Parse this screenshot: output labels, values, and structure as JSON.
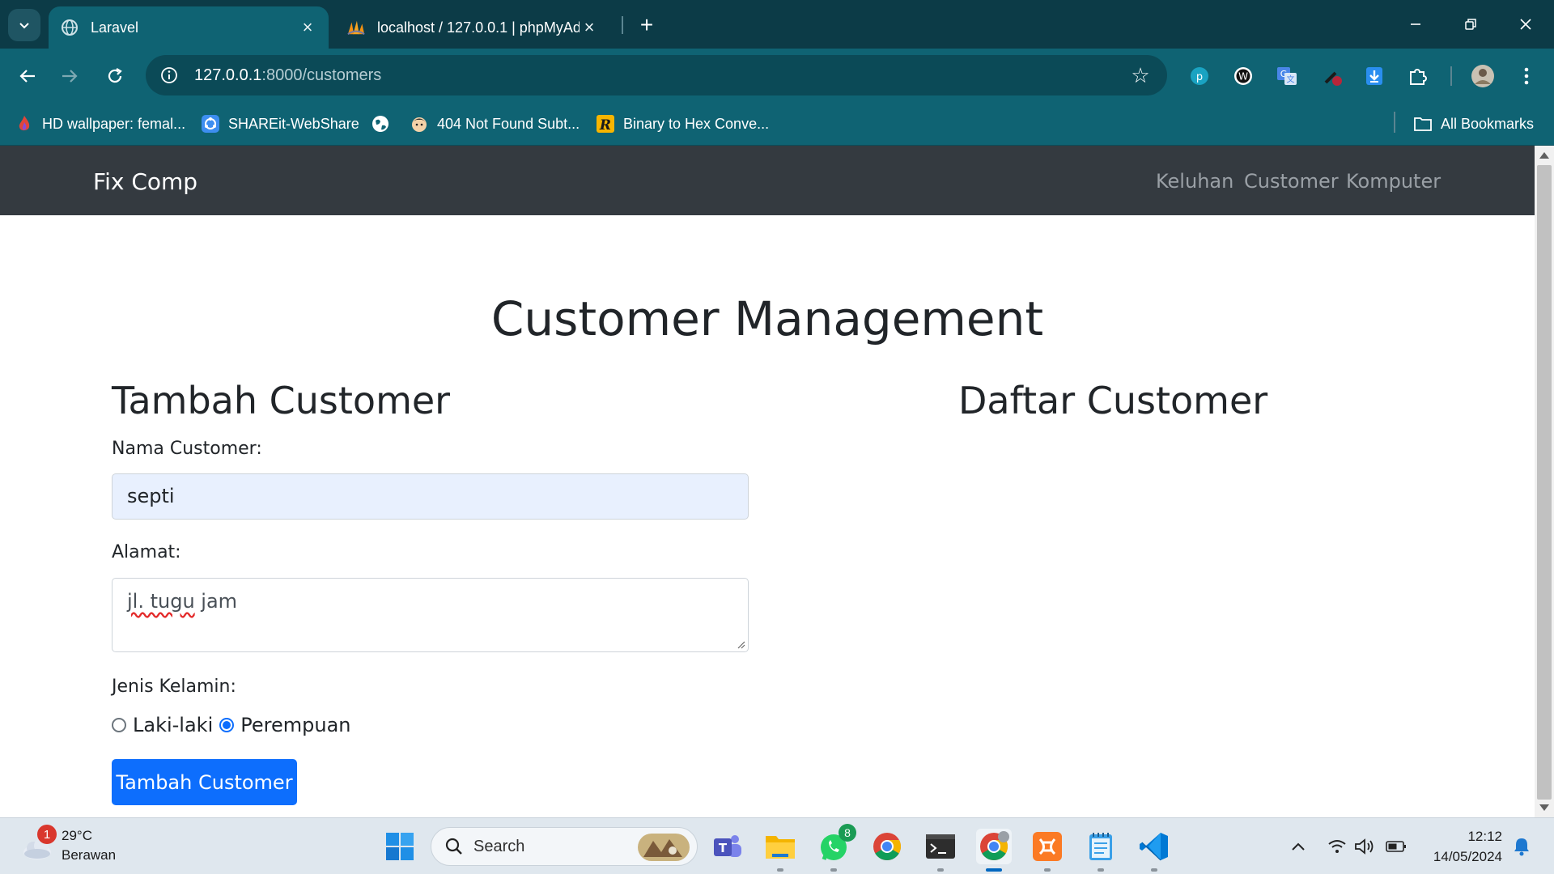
{
  "browser": {
    "tabs": [
      {
        "title": "Laravel",
        "active": true,
        "icon": "globe-icon"
      },
      {
        "title": "localhost / 127.0.0.1 | phpMyAd",
        "active": false,
        "icon": "phpmyadmin-icon"
      }
    ],
    "url_host": "127.0.0.1",
    "url_rest": ":8000/customers",
    "bookmarks": [
      {
        "label": "HD wallpaper: femal...",
        "icon": "flame-icon"
      },
      {
        "label": "SHAREit-WebShare",
        "icon": "shareit-icon"
      },
      {
        "label": "",
        "icon": "globe-icon"
      },
      {
        "label": "404 Not Found Subt...",
        "icon": "character-icon"
      },
      {
        "label": "Binary to Hex Conve...",
        "icon": "r-logo-icon"
      }
    ],
    "all_bookmarks": "All Bookmarks"
  },
  "app": {
    "brand": "Fix Comp",
    "nav": [
      "Keluhan",
      "Customer",
      "Komputer"
    ],
    "page_title": "Customer Management",
    "form": {
      "heading": "Tambah Customer",
      "name_label": "Nama Customer:",
      "name_value": "septi",
      "address_label": "Alamat:",
      "address_value_part1": "jl. tugu",
      "address_value_part2": " jam",
      "gender_label": "Jenis Kelamin:",
      "gender_options": [
        "Laki-laki",
        "Perempuan"
      ],
      "gender_selected": "Perempuan",
      "submit": "Tambah Customer"
    },
    "list": {
      "heading": "Daftar Customer"
    }
  },
  "taskbar": {
    "weather_temp": "29°C",
    "weather_desc": "Berawan",
    "weather_badge": "1",
    "search_placeholder": "Search",
    "whatsapp_badge": "8",
    "time": "12:12",
    "date": "14/05/2024"
  },
  "colors": {
    "chrome_dark": "#0c3b47",
    "chrome": "#0f6373",
    "navbar": "#343a40",
    "primary": "#0d6efd",
    "autofill": "#e8f0fe"
  }
}
